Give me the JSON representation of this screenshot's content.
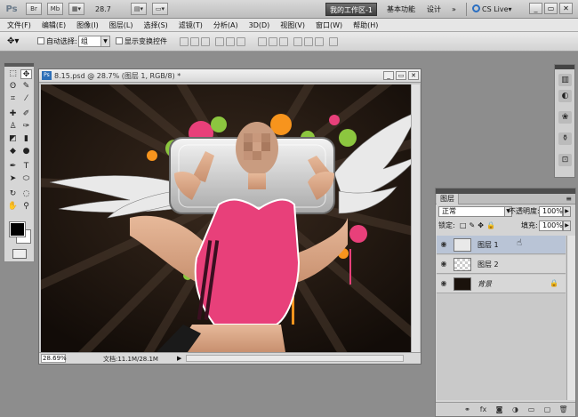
{
  "appbar": {
    "logo": "Ps",
    "bridge": "Br",
    "minibridge": "Mb",
    "zoom": "28.7",
    "active_workspace": "我的工作区-1",
    "workspace_basic": "基本功能",
    "workspace_design": "设计",
    "more": "»",
    "cs_live": "CS Live▾"
  },
  "menu": [
    "文件(F)",
    "编辑(E)",
    "图像(I)",
    "图层(L)",
    "选择(S)",
    "滤镜(T)",
    "分析(A)",
    "3D(D)",
    "视图(V)",
    "窗口(W)",
    "帮助(H)"
  ],
  "options": {
    "auto_select_label": "自动选择:",
    "auto_select_value": "组",
    "show_transform_label": "显示变换控件"
  },
  "document": {
    "title": "8.15.psd @ 28.7% (图层 1, RGB/8) *",
    "zoom": "28.69%",
    "doc_info": "文档:11.1M/28.1M"
  },
  "layers_panel": {
    "tab": "图层",
    "blend_mode": "正常",
    "opacity_label": "不透明度:",
    "opacity": "100%",
    "lock_label": "锁定:",
    "fill_label": "填充:",
    "fill": "100%",
    "layers": [
      {
        "name": "图层 1",
        "active": true
      },
      {
        "name": "图层 2",
        "active": false
      },
      {
        "name": "背景",
        "active": false,
        "locked": true
      }
    ]
  },
  "colors": {
    "canvas_bg": "#1e150f",
    "shirt_pink": "#e8407a",
    "accent_blue": "#2b6fc2"
  }
}
